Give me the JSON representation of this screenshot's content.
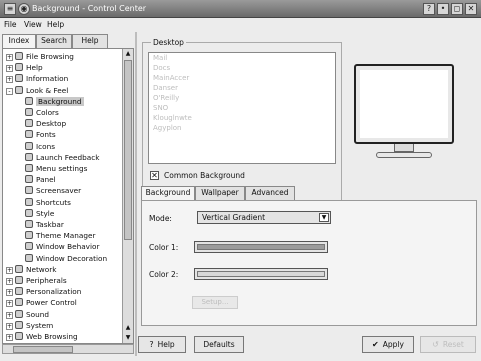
{
  "window": {
    "title": "Background - Control Center",
    "controls": {
      "help": "?",
      "minimize": "•",
      "maximize": "◻",
      "close": "✕"
    }
  },
  "menubar": {
    "file": "File",
    "view": "View",
    "help": "Help"
  },
  "sidebar": {
    "tabs": [
      "Index",
      "Search",
      "Help"
    ],
    "active_tab": "Index",
    "tree": [
      {
        "label": "File Browsing",
        "level": 0,
        "icon": "folder-icon",
        "expander": "+"
      },
      {
        "label": "Help",
        "level": 0,
        "icon": "help-icon",
        "expander": "+"
      },
      {
        "label": "Information",
        "level": 0,
        "icon": "info-icon",
        "expander": "+"
      },
      {
        "label": "Look & Feel",
        "level": 0,
        "icon": "look-feel-icon",
        "expander": "-"
      },
      {
        "label": "Background",
        "level": 1,
        "icon": "background-icon",
        "selected": true
      },
      {
        "label": "Colors",
        "level": 1,
        "icon": "colors-icon"
      },
      {
        "label": "Desktop",
        "level": 1,
        "icon": "desktop-icon"
      },
      {
        "label": "Fonts",
        "level": 1,
        "icon": "fonts-icon"
      },
      {
        "label": "Icons",
        "level": 1,
        "icon": "icons-icon"
      },
      {
        "label": "Launch Feedback",
        "level": 1,
        "icon": "launch-feedback-icon"
      },
      {
        "label": "Menu settings",
        "level": 1,
        "icon": "menu-settings-icon"
      },
      {
        "label": "Panel",
        "level": 1,
        "icon": "panel-icon"
      },
      {
        "label": "Screensaver",
        "level": 1,
        "icon": "screensaver-icon"
      },
      {
        "label": "Shortcuts",
        "level": 1,
        "icon": "shortcuts-icon"
      },
      {
        "label": "Style",
        "level": 1,
        "icon": "style-icon"
      },
      {
        "label": "Taskbar",
        "level": 1,
        "icon": "taskbar-icon"
      },
      {
        "label": "Theme Manager",
        "level": 1,
        "icon": "theme-manager-icon"
      },
      {
        "label": "Window Behavior",
        "level": 1,
        "icon": "window-behavior-icon"
      },
      {
        "label": "Window Decoration",
        "level": 1,
        "icon": "window-decoration-icon"
      },
      {
        "label": "Network",
        "level": 0,
        "icon": "network-icon",
        "expander": "+"
      },
      {
        "label": "Peripherals",
        "level": 0,
        "icon": "peripherals-icon",
        "expander": "+"
      },
      {
        "label": "Personalization",
        "level": 0,
        "icon": "personalization-icon",
        "expander": "+"
      },
      {
        "label": "Power Control",
        "level": 0,
        "icon": "power-control-icon",
        "expander": "+"
      },
      {
        "label": "Sound",
        "level": 0,
        "icon": "sound-icon",
        "expander": "+"
      },
      {
        "label": "System",
        "level": 0,
        "icon": "system-icon",
        "expander": "+"
      },
      {
        "label": "Web Browsing",
        "level": 0,
        "icon": "web-browsing-icon",
        "expander": "+"
      }
    ]
  },
  "desktop_group": {
    "title": "Desktop",
    "desktops": [
      "Mail",
      "Docs",
      "MainAccer",
      "Danser",
      "O'Reilly",
      "SNO",
      "Klouglnwte",
      "Agyplon"
    ],
    "common_background_label": "Common Background",
    "common_background_checked": true,
    "check_mark": "✕"
  },
  "panel_tabs": [
    "Background",
    "Wallpaper",
    "Advanced"
  ],
  "active_panel_tab": "Background",
  "background": {
    "mode_label": "Mode:",
    "mode_value": "Vertical Gradient",
    "color1_label": "Color 1:",
    "color2_label": "Color 2:",
    "color1": "#9c9c9c",
    "color2": "#d8d8d8",
    "setup_button": "Setup..."
  },
  "buttons": {
    "help": "Help",
    "defaults": "Defaults",
    "apply": "Apply",
    "reset": "Reset"
  },
  "colors": {
    "titlebar": "#7a7a7a",
    "window_bg": "#ececec",
    "selection": "#c8c8c8"
  }
}
